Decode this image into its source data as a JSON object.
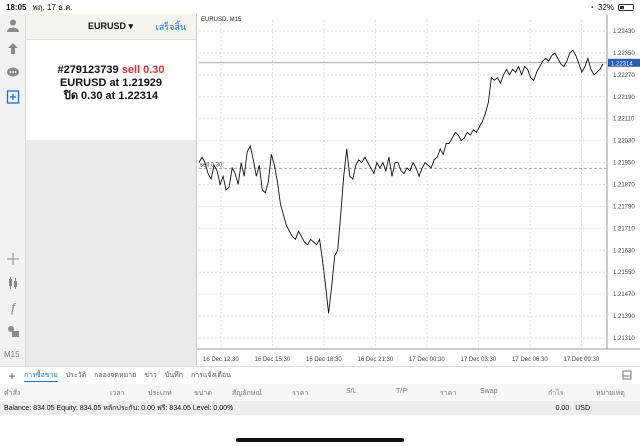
{
  "status": {
    "time": "18:05",
    "date": "พฤ. 17 ธ.ค.",
    "battery": "32%"
  },
  "toolbar": {
    "icons": [
      "user-icon",
      "share-icon",
      "chat-icon",
      "new-order-icon",
      "crosshair-icon",
      "candles-icon",
      "indicator-icon",
      "objects-icon"
    ],
    "timeframe": "M15"
  },
  "panel": {
    "symbol": "EURUSD ▾",
    "done_label": "เสร็จสิ้น",
    "order_id": "#279123739",
    "side_volume": "sell 0.30",
    "line2": "EURUSD at 1.21929",
    "line3": "ปิด 0.30 at 1.22314"
  },
  "chart": {
    "header": "EURUSD, M15",
    "order_label": "sell 0.30",
    "price_tag": "1.22314",
    "colors": {
      "line": "#111111",
      "tag": "#2a5db0",
      "grid": "#dddddd"
    }
  },
  "chart_data": {
    "type": "line",
    "x_ticks": [
      "16 Dec 12:30",
      "16 Dec 15:30",
      "16 Dec 18:30",
      "16 Dec 21:30",
      "17 Dec 00:30",
      "17 Dec 03:30",
      "17 Dec 06:30",
      "17 Dec 09:30"
    ],
    "y_ticks": [
      "1.22430",
      "1.22350",
      "1.22270",
      "1.22190",
      "1.22110",
      "1.22030",
      "1.21950",
      "1.21870",
      "1.21790",
      "1.21710",
      "1.21630",
      "1.21550",
      "1.21470",
      "1.21390",
      "1.21310"
    ],
    "ylim": [
      1.2127,
      1.2247
    ],
    "sell_level": 1.21929,
    "close_level": 1.22314,
    "values": [
      1.2195,
      1.2197,
      1.2195,
      1.2191,
      1.2189,
      1.2194,
      1.2192,
      1.2187,
      1.219,
      1.2185,
      1.2186,
      1.2193,
      1.2191,
      1.2187,
      1.2195,
      1.219,
      1.2199,
      1.2201,
      1.2196,
      1.219,
      1.2194,
      1.2185,
      1.2184,
      1.2188,
      1.2198,
      1.2194,
      1.2188,
      1.218,
      1.2176,
      1.2172,
      1.217,
      1.2168,
      1.2167,
      1.217,
      1.2168,
      1.2166,
      1.2165,
      1.2167,
      1.2166,
      1.2165,
      1.2167,
      1.2159,
      1.215,
      1.214,
      1.215,
      1.2161,
      1.2163,
      1.2176,
      1.219,
      1.22,
      1.219,
      1.2189,
      1.2194,
      1.2196,
      1.2195,
      1.2197,
      1.2195,
      1.2193,
      1.2191,
      1.2195,
      1.2193,
      1.2195,
      1.2192,
      1.2197,
      1.219,
      1.2195,
      1.2195,
      1.2192,
      1.2191,
      1.2193,
      1.2192,
      1.2195,
      1.2193,
      1.219,
      1.2193,
      1.2195,
      1.2194,
      1.2193,
      1.2196,
      1.2197,
      1.22,
      1.2198,
      1.2202,
      1.2202,
      1.2204,
      1.2206,
      1.2205,
      1.2203,
      1.2204,
      1.2206,
      1.2205,
      1.2207,
      1.2206,
      1.2208,
      1.221,
      1.2213,
      1.2217,
      1.2226,
      1.2225,
      1.2226,
      1.2224,
      1.2227,
      1.2229,
      1.2227,
      1.2229,
      1.2228,
      1.223,
      1.2227,
      1.223,
      1.2229,
      1.2226,
      1.2225,
      1.2228,
      1.223,
      1.2232,
      1.2233,
      1.2232,
      1.2234,
      1.2235,
      1.2233,
      1.2231,
      1.223,
      1.2232,
      1.2235,
      1.2236,
      1.2234,
      1.2231,
      1.2228,
      1.223,
      1.2233,
      1.2229,
      1.2227,
      1.2228,
      1.2229,
      1.2231
    ]
  },
  "bottom_tabs": {
    "add": "+",
    "tabs": [
      "การซื้อขาย",
      "ประวัติ",
      "กล่องจดหมาย",
      "ข่าว",
      "บันทึก",
      "การแจ้งเตือน"
    ]
  },
  "columns": [
    "คำสั่ง",
    "เวลา",
    "ประเภท",
    "ขนาด",
    "สัญลักษณ์",
    "ราคา",
    "S/L",
    "T/P",
    "ราคา",
    "Swap",
    "กำไร",
    "หมายเหตุ"
  ],
  "balance": {
    "text": "Balance: 834.05 Equity: 834.05 หลักประกัน: 0.00 ฟรี: 834.05 Level: 0.00%",
    "profit": "0.00",
    "currency": "USD"
  }
}
